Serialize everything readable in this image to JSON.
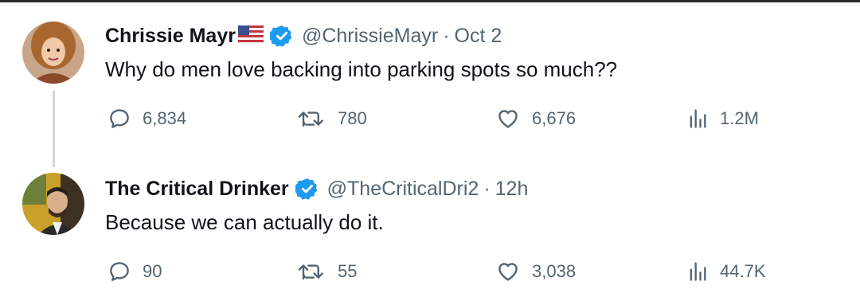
{
  "tweets": [
    {
      "author_name": "Chrissie Mayr",
      "flag": "us-flag-icon",
      "handle": "@ChrissieMayr",
      "separator": "·",
      "time": "Oct 2",
      "text": "Why do men love backing into parking spots so much??",
      "stats": {
        "replies": "6,834",
        "reposts": "780",
        "likes": "6,676",
        "views": "1.2M"
      }
    },
    {
      "author_name": "The Critical Drinker",
      "handle": "@TheCriticalDri2",
      "separator": "·",
      "time": "12h",
      "text": "Because we can actually do it.",
      "stats": {
        "replies": "90",
        "reposts": "55",
        "likes": "3,038",
        "views": "44.7K"
      }
    }
  ],
  "colors": {
    "verified": "#1d9bf0",
    "muted": "#536471",
    "text": "#0f1419",
    "thread_line": "#cfd9de"
  }
}
